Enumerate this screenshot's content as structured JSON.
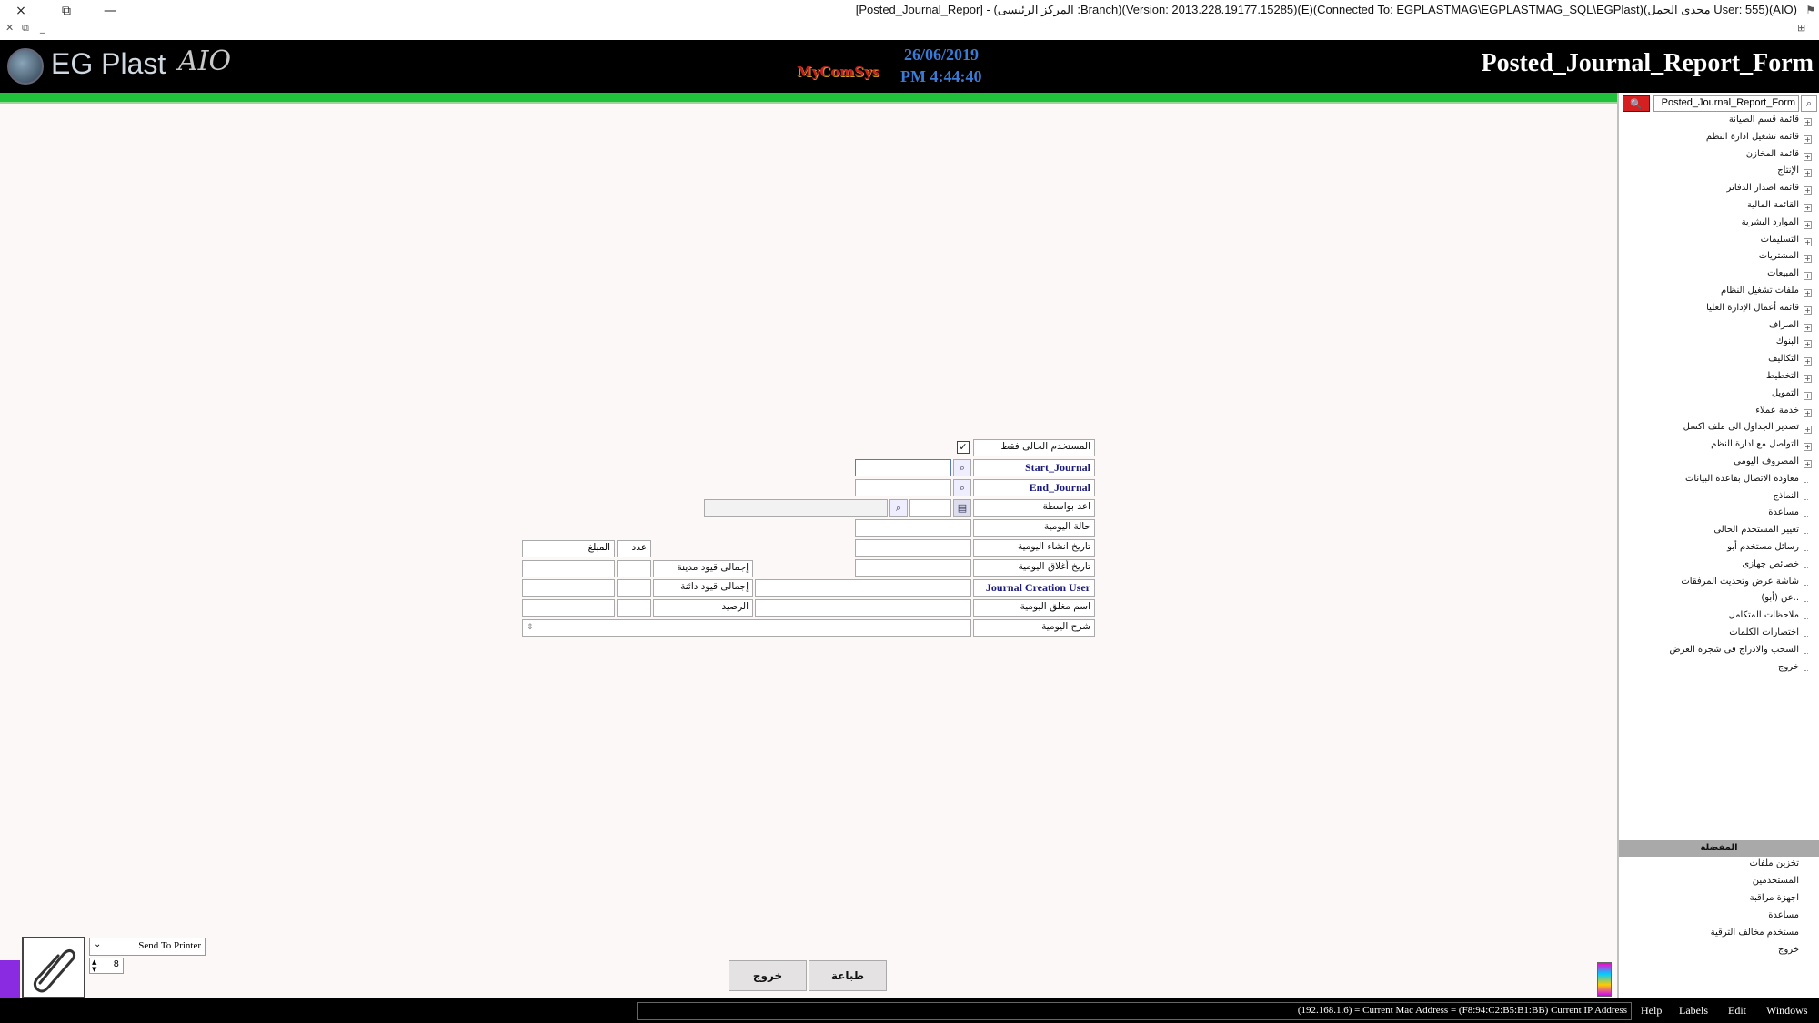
{
  "window": {
    "title": "[Posted_Journal_Repor] - (المركز الرئيسى :Branch)(Version: 2013.228.19177.15285)(E)(Connected To: EGPLASTMAG\\EGPLASTMAG_SQL\\EGPlast)(مجدى الجمل User: 555)(AIO)",
    "close_icon": "×",
    "restore_icon": "⧉",
    "minimize_icon": "—"
  },
  "header": {
    "logo_text": "EG Plast",
    "logo_script": "AIO",
    "center_logo": "MyComSys",
    "date": "26/06/2019",
    "time": "PM 4:44:40",
    "form_title": "Posted_Journal_Report_Form"
  },
  "sidebar": {
    "search_value": "Posted_Journal_Report_Form",
    "items": [
      {
        "label": "قائمة قسم الصيانة",
        "expandable": true
      },
      {
        "label": "قائمة تشغيل ادارة النظم",
        "expandable": true
      },
      {
        "label": "قائمة المخازن",
        "expandable": true
      },
      {
        "label": "الإنتاج",
        "expandable": true
      },
      {
        "label": "قائمة اصدار الدفاتر",
        "expandable": true
      },
      {
        "label": "القائمة المالية",
        "expandable": true
      },
      {
        "label": "الموارد البشرية",
        "expandable": true
      },
      {
        "label": "التسليمات",
        "expandable": true
      },
      {
        "label": "المشتريات",
        "expandable": true
      },
      {
        "label": "المبيعات",
        "expandable": true
      },
      {
        "label": "ملفات تشغيل النظام",
        "expandable": true
      },
      {
        "label": "قائمة أعمال الإدارة العليا",
        "expandable": true
      },
      {
        "label": "الصراف",
        "expandable": true
      },
      {
        "label": "البنوك",
        "expandable": true
      },
      {
        "label": "التكاليف",
        "expandable": true
      },
      {
        "label": "التخطيط",
        "expandable": true
      },
      {
        "label": "التمويل",
        "expandable": true
      },
      {
        "label": "خدمة عملاء",
        "expandable": true
      },
      {
        "label": "تصدير الجداول الى ملف اكسل",
        "expandable": true
      },
      {
        "label": "التواصل مع ادارة النظم",
        "expandable": true
      },
      {
        "label": "المصروف اليومى",
        "expandable": true
      },
      {
        "label": "معاودة الاتصال بقاعدة البيانات",
        "expandable": false
      },
      {
        "label": "النماذج",
        "expandable": false
      },
      {
        "label": "مساعدة",
        "expandable": false
      },
      {
        "label": "تغيير المستخدم الحالى",
        "expandable": false
      },
      {
        "label": "رسائل مستخدم أبو",
        "expandable": false
      },
      {
        "label": "خصائص جهازى",
        "expandable": false
      },
      {
        "label": "شاشة عرض وتحديث المرفقات",
        "expandable": false
      },
      {
        "label": "عن (أبو)..",
        "expandable": false
      },
      {
        "label": "ملاحظات المتكامل",
        "expandable": false
      },
      {
        "label": "اختصارات الكلمات",
        "expandable": false
      },
      {
        "label": "السحب والادراج فى شجرة العرض",
        "expandable": false
      },
      {
        "label": "خروج",
        "expandable": false
      }
    ],
    "favorites_title": "المفضلة",
    "favorites": [
      "تخزين ملفات",
      "المستخدمين",
      "اجهزة مراقبة",
      "مساعدة",
      "مستخدم مخالف الترقية",
      "خروج"
    ]
  },
  "form": {
    "current_user_only_label": "المستخدم الحالى فقط",
    "current_user_only_checked": "✓",
    "start_journal_label": "Start_Journal",
    "end_journal_label": "End_Journal",
    "prepared_by_label": "اعد بواسطة",
    "journal_status_label": "حالة اليومية",
    "journal_creation_date_label": "تاريخ انشاء اليومية",
    "journal_close_date_label": "تاريخ أغلاق اليومية",
    "journal_creation_user_label": "Journal Creation User",
    "journal_closer_name_label": "اسم مغلق اليومية",
    "journal_description_label": "شرح اليومية",
    "count_header": "عدد",
    "amount_header": "المبلغ",
    "total_debit_label": "إجمالى قيود مدينة",
    "total_credit_label": "إجمالى قيود دائنة",
    "balance_label": "الرصيد"
  },
  "actions": {
    "print_label": "طباعة",
    "exit_label": "خروج",
    "send_to_printer": "Send To Printer",
    "copies": "8"
  },
  "statusbar": {
    "ip_text": "(192.168.1.6) = Current Mac Address = (F8:94:C2:B5:B1:BB) Current IP Address",
    "menu": [
      "Help",
      "Labels",
      "Edit",
      "Windows"
    ]
  },
  "colors": {
    "accent_green": "#1fc23a",
    "date_blue": "#3a7bd5",
    "label_navy": "#1a1a7a",
    "search_red": "#d42020"
  }
}
